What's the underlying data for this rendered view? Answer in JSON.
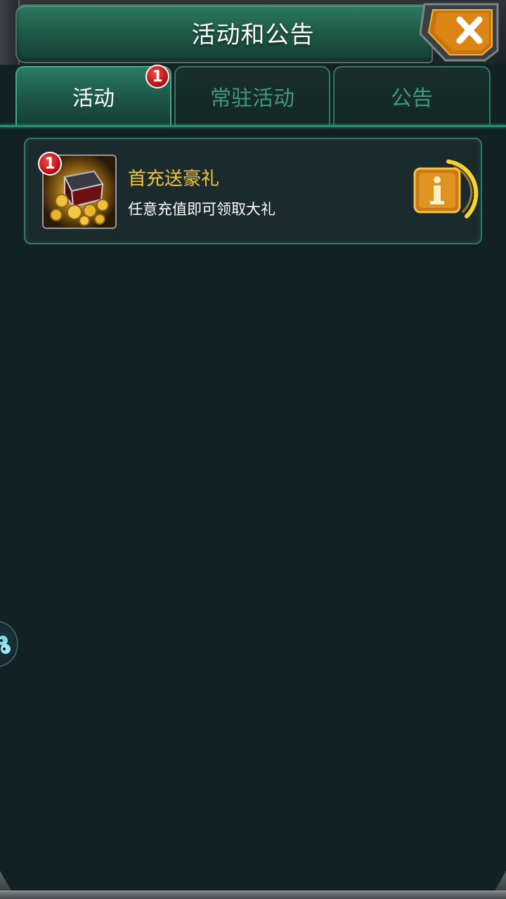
{
  "header": {
    "title": "活动和公告",
    "close_icon": "close-x-icon"
  },
  "tabs": [
    {
      "label": "活动",
      "active": true,
      "badge": "1"
    },
    {
      "label": "常驻活动",
      "active": false
    },
    {
      "label": "公告",
      "active": false
    }
  ],
  "activities": [
    {
      "title": "首充送豪礼",
      "description": "任意充值即可领取大礼",
      "badge": "1",
      "icon": "treasure-chest-icon",
      "info_icon": "info-icon"
    }
  ],
  "colors": {
    "accent_green": "#2f7a64",
    "title_gold": "#f3c43e",
    "badge_red": "#c8161a",
    "background": "#122224"
  }
}
